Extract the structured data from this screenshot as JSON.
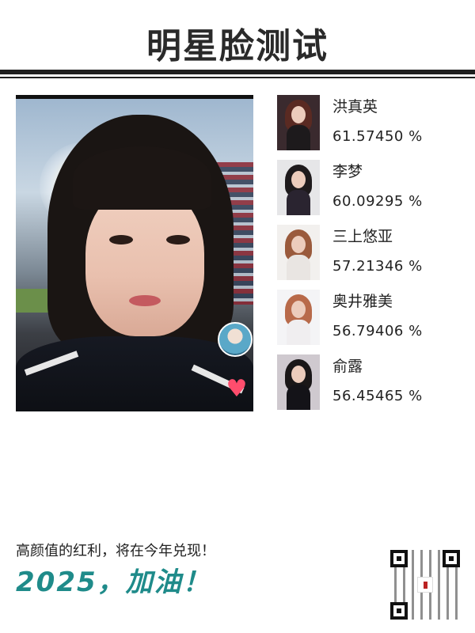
{
  "header": {
    "title": "明星脸测试"
  },
  "photo": {
    "description_icon": "selfie-photo"
  },
  "results": [
    {
      "name": "洪真英",
      "score": "61.57450 %",
      "hair": "#5a2a22",
      "bg": "#3a2a2e",
      "body": "#1d1a1c"
    },
    {
      "name": "李梦",
      "score": "60.09295 %",
      "hair": "#1e1a1c",
      "bg": "#e6e6e8",
      "body": "#2a2430"
    },
    {
      "name": "三上悠亚",
      "score": "57.21346 %",
      "hair": "#9a5a3c",
      "bg": "#f2f0ee",
      "body": "#e9e5e2"
    },
    {
      "name": "奥井雅美",
      "score": "56.79406 %",
      "hair": "#b86a4a",
      "bg": "#f4f4f6",
      "body": "#f0eef0"
    },
    {
      "name": "俞露",
      "score": "56.45465 %",
      "hair": "#1a1718",
      "bg": "#cfc9cf",
      "body": "#141318"
    }
  ],
  "footer": {
    "line1": "高颜值的红利，将在今年兑现！",
    "line2": "2025，加油！",
    "qr_icon": "qr-code"
  },
  "colors": {
    "accent": "#1f8b8a",
    "heart": "#ff4d6d",
    "rule": "#1f1f1f"
  }
}
